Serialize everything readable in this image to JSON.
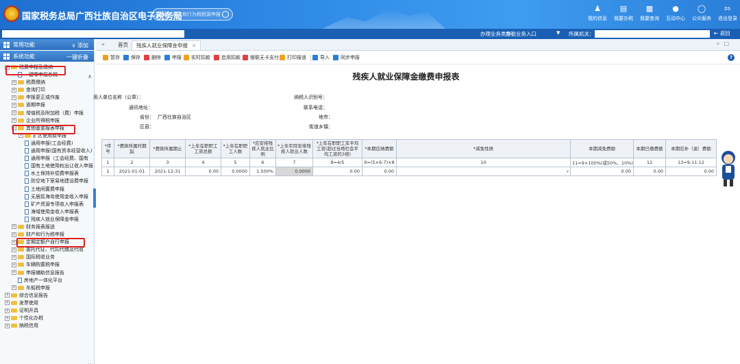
{
  "header": {
    "title": "国家税务总局广西壮族自治区电子税务局",
    "search_placeholder": "搜索：财产和行为税税源申报",
    "nav": [
      {
        "label": "我的信息",
        "icon": "user-icon"
      },
      {
        "label": "我要办税",
        "icon": "monitor-icon"
      },
      {
        "label": "我要查询",
        "icon": "chart-icon"
      },
      {
        "label": "互动中心",
        "icon": "chat-icon"
      },
      {
        "label": "公众服务",
        "icon": "service-icon"
      },
      {
        "label": "退出登录",
        "icon": "logout-icon"
      }
    ]
  },
  "bar2": {
    "business_label": "办理业务类型：",
    "business_value": "办税业务入口",
    "org_label": "所属机关：",
    "back_label": "返回"
  },
  "sidebar": {
    "common_label": "常用功能",
    "common_action": "添加",
    "system_label": "系统功能",
    "system_action": "一键折叠",
    "tree": [
      {
        "level": 0,
        "toggle": "−",
        "type": "folder",
        "label": "税费申报及缴纳"
      },
      {
        "level": 1,
        "toggle": "",
        "type": "file",
        "label": "一键零申报各税"
      },
      {
        "level": 1,
        "toggle": "+",
        "type": "folder",
        "label": "税费缴纳"
      },
      {
        "level": 1,
        "toggle": "+",
        "type": "folder",
        "label": "查询打印"
      },
      {
        "level": 1,
        "toggle": "+",
        "type": "folder",
        "label": "申报更正或作废"
      },
      {
        "level": 1,
        "toggle": "+",
        "type": "folder",
        "label": "逾期申报"
      },
      {
        "level": 1,
        "toggle": "+",
        "type": "folder",
        "label": "增值税及附加税（费）申报"
      },
      {
        "level": 1,
        "toggle": "+",
        "type": "folder",
        "label": "企业所得税申报"
      },
      {
        "level": 1,
        "toggle": "−",
        "type": "folder",
        "label": "其他基金报表申报"
      },
      {
        "level": 2,
        "toggle": "+",
        "type": "folder",
        "label": "扩区使用费申报"
      },
      {
        "level": 2,
        "toggle": "",
        "type": "file",
        "label": "通用申报(工会经费)"
      },
      {
        "level": 2,
        "toggle": "",
        "type": "file",
        "label": "通用申报(国有资本经营收入)"
      },
      {
        "level": 2,
        "toggle": "",
        "type": "file",
        "label": "通用申报（工会经费、国有"
      },
      {
        "level": 2,
        "toggle": "",
        "type": "file",
        "label": "国有土地使用权出让收入申报表"
      },
      {
        "level": 2,
        "toggle": "",
        "type": "file",
        "label": "水土保持补偿费申报表"
      },
      {
        "level": 2,
        "toggle": "",
        "type": "file",
        "label": "防空地下室易地建设费申报"
      },
      {
        "level": 2,
        "toggle": "",
        "type": "file",
        "label": "土地闲置费申报"
      },
      {
        "level": 2,
        "toggle": "",
        "type": "file",
        "label": "无居民海岛使用金收入申报"
      },
      {
        "level": 2,
        "toggle": "",
        "type": "file",
        "label": "矿产资源专项收入申报表"
      },
      {
        "level": 2,
        "toggle": "",
        "type": "file",
        "label": "海域使用金收入申报表"
      },
      {
        "level": 2,
        "toggle": "",
        "type": "file",
        "label": "残疾人就业保障金申报"
      },
      {
        "level": 1,
        "toggle": "+",
        "type": "folder",
        "label": "财务报表报送"
      },
      {
        "level": 1,
        "toggle": "+",
        "type": "folder",
        "label": "财产和行为税申报"
      },
      {
        "level": 1,
        "toggle": "+",
        "type": "folder",
        "label": "定期定额户自行申报"
      },
      {
        "level": 1,
        "toggle": "+",
        "type": "folder",
        "label": "委托代征、代扣代缴及代收"
      },
      {
        "level": 1,
        "toggle": "+",
        "type": "folder",
        "label": "国际税收业务"
      },
      {
        "level": 1,
        "toggle": "+",
        "type": "folder",
        "label": "车辆购置税申报"
      },
      {
        "level": 1,
        "toggle": "+",
        "type": "folder",
        "label": "申报辅助信息报告"
      },
      {
        "level": 1,
        "toggle": "",
        "type": "file",
        "label": "房地产一体化平台"
      },
      {
        "level": 1,
        "toggle": "+",
        "type": "folder",
        "label": "车船税申报"
      },
      {
        "level": 0,
        "toggle": "+",
        "type": "folder",
        "label": "综合信息报告"
      },
      {
        "level": 0,
        "toggle": "+",
        "type": "folder",
        "label": "发票使用"
      },
      {
        "level": 0,
        "toggle": "+",
        "type": "folder",
        "label": "证明开具"
      },
      {
        "level": 0,
        "toggle": "+",
        "type": "folder",
        "label": "个性化办税"
      },
      {
        "level": 0,
        "toggle": "+",
        "type": "folder",
        "label": "納税信用"
      }
    ]
  },
  "tabs": {
    "home": "首页",
    "active": "残疾人就业保障金申报"
  },
  "toolbar": [
    {
      "label": "暂存",
      "color": "#f0a020"
    },
    {
      "label": "保存",
      "color": "#2a7ed8"
    },
    {
      "label": "删除",
      "color": "#e04040"
    },
    {
      "label": "申报",
      "color": "#2a7ed8"
    },
    {
      "label": "实时扣款",
      "color": "#f0a020"
    },
    {
      "label": "启用扣款",
      "color": "#e04040"
    },
    {
      "label": "银联无卡支付",
      "color": "#e04040"
    },
    {
      "label": "打印报道",
      "color": "#f0a020"
    },
    {
      "label": "导入",
      "color": "#2a7ed8"
    },
    {
      "label": "同步申报",
      "color": "#2a7ed8"
    }
  ],
  "form": {
    "title": "残疾人就业保障金缴费申报表",
    "employer_label": "用人单位名称（公章）：",
    "address_label": "通讯地址：",
    "province_label": "省份：",
    "province_value": "广西壮族自治区",
    "district_label": "区县：",
    "taxid_label": "纳税人识别号：",
    "phone_label": "联系电话：",
    "city_label": "地市：",
    "street_label": "街道乡镇："
  },
  "table": {
    "headers": [
      "*序号",
      "*费款所属时期起",
      "*费款所属期止",
      "*上年在职职工工资总额",
      "*上年在职职工人数",
      "*应安排残疾人就业比例",
      "*上年实际安排残疾人就业人数",
      "*上年在职职工年平均工资(超过当地社会平均工资的3倍)",
      "*本期应纳费额",
      "*减免性质",
      "本期减免费额",
      "本期已缴费额",
      "本期应补（退）费额"
    ],
    "seq": [
      "1",
      "2",
      "3",
      "4",
      "5",
      "6",
      "7",
      "8=4/5",
      "9=(5×6-7)×8",
      "10",
      "11=9×100%(或50%、10%)",
      "12",
      "13=9-11-12"
    ],
    "row": [
      "1",
      "2021-01-01",
      "2021-12-31",
      "0.00",
      "0.0000",
      "1.500%",
      "0.0000",
      "0.00",
      "0.00",
      "",
      "0.00",
      "0.00",
      "0.00"
    ]
  }
}
